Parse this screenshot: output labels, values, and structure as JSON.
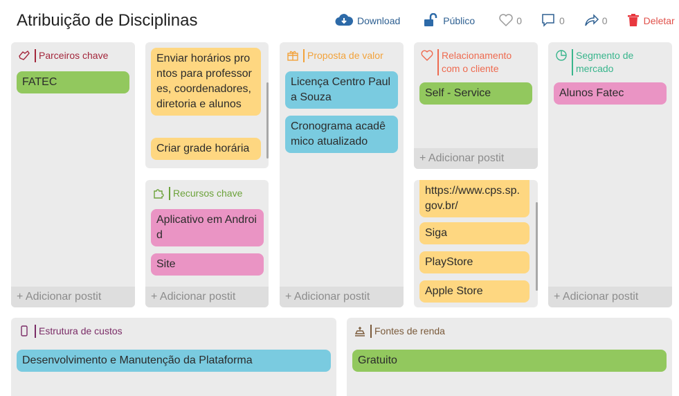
{
  "header": {
    "title": "Atribuição de Disciplinas",
    "download_label": "Download",
    "public_label": "Público",
    "likes": "0",
    "comments": "0",
    "shares": "0",
    "delete_label": "Deletar"
  },
  "add_label": "+ Adicionar postit",
  "parceiros": {
    "title": "Parceiros chave",
    "items": [
      "FATEC"
    ]
  },
  "atividades": {
    "items": [
      "Enviar horários prontos para professores, coordenadores, diretoria e alunos",
      "Criar grade horária"
    ]
  },
  "recursos": {
    "title": "Recursos chave",
    "items": [
      "Aplicativo em Android",
      "Site"
    ]
  },
  "proposta": {
    "title": "Proposta de valor",
    "items": [
      "Licença Centro Paula Souza",
      "Cronograma acadêmico atualizado"
    ]
  },
  "relacionamento": {
    "title": "Relacionamento com o cliente",
    "items": [
      "Self - Service"
    ]
  },
  "canais": {
    "items": [
      "https://www.cps.sp.gov.br/",
      "Siga",
      "PlayStore",
      "Apple Store"
    ]
  },
  "segmento": {
    "title": "Segmento de mercado",
    "items": [
      "Alunos Fatec"
    ]
  },
  "custos": {
    "title": "Estrutura de custos",
    "items": [
      "Desenvolvimento e Manutenção da Plataforma"
    ]
  },
  "renda": {
    "title": "Fontes de renda",
    "items": [
      "Gratuito"
    ]
  },
  "colors": {
    "parceiros": "#a3263b",
    "recursos": "#6ca23a",
    "proposta": "#f2a23a",
    "relacionamento": "#ee6a4f",
    "segmento": "#38b58c",
    "custos": "#7a2b66",
    "renda": "#7a5a3a"
  }
}
